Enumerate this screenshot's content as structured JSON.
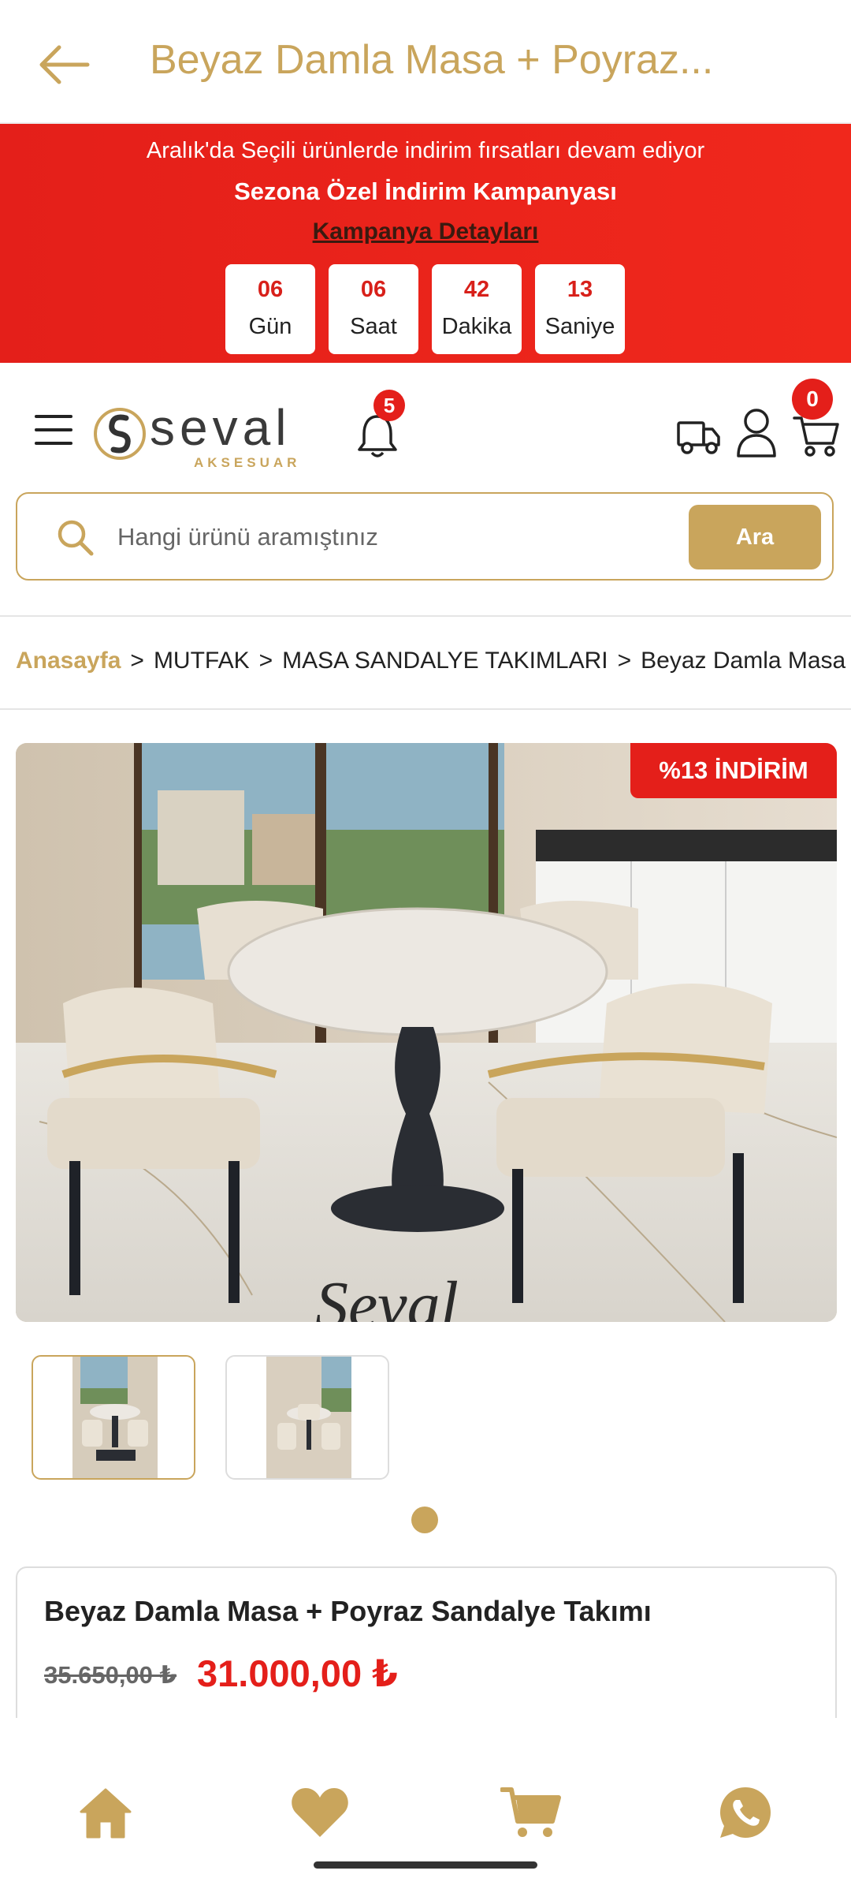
{
  "topbar": {
    "title": "Beyaz Damla Masa + Poyraz..."
  },
  "promo": {
    "line1": "Aralık'da Seçili ürünlerde indirim fırsatları devam ediyor",
    "line2": "Sezona Özel İndirim Kampanyası",
    "details_link": "Kampanya Detayları",
    "countdown": [
      {
        "value": "06",
        "label": "Gün"
      },
      {
        "value": "06",
        "label": "Saat"
      },
      {
        "value": "42",
        "label": "Dakika"
      },
      {
        "value": "13",
        "label": "Saniye"
      }
    ]
  },
  "header": {
    "logo_text": "seval",
    "logo_subtext": "AKSESUAR",
    "notification_count": "5",
    "cart_count": "0"
  },
  "search": {
    "placeholder": "Hangi ürünü aramıştınız",
    "button_label": "Ara"
  },
  "breadcrumb": {
    "home": "Anasayfa",
    "separator": ">",
    "items": [
      "MUTFAK",
      "MASA SANDALYE TAKIMLARI",
      "Beyaz Damla Masa"
    ]
  },
  "product": {
    "discount_badge": "%13 İNDİRİM",
    "watermark": "Seval",
    "name": "Beyaz Damla Masa + Poyraz Sandalye Takımı",
    "old_price": "35.650,00 ₺",
    "new_price": "31.000,00 ₺",
    "image_count": 2,
    "active_image": 1
  },
  "colors": {
    "gold": "#c9a55c",
    "red": "#e41f1a"
  },
  "icons": [
    "back-arrow-icon",
    "menu-icon",
    "bell-icon",
    "truck-icon",
    "user-icon",
    "cart-icon",
    "search-icon",
    "home-icon",
    "heart-icon",
    "whatsapp-icon"
  ]
}
